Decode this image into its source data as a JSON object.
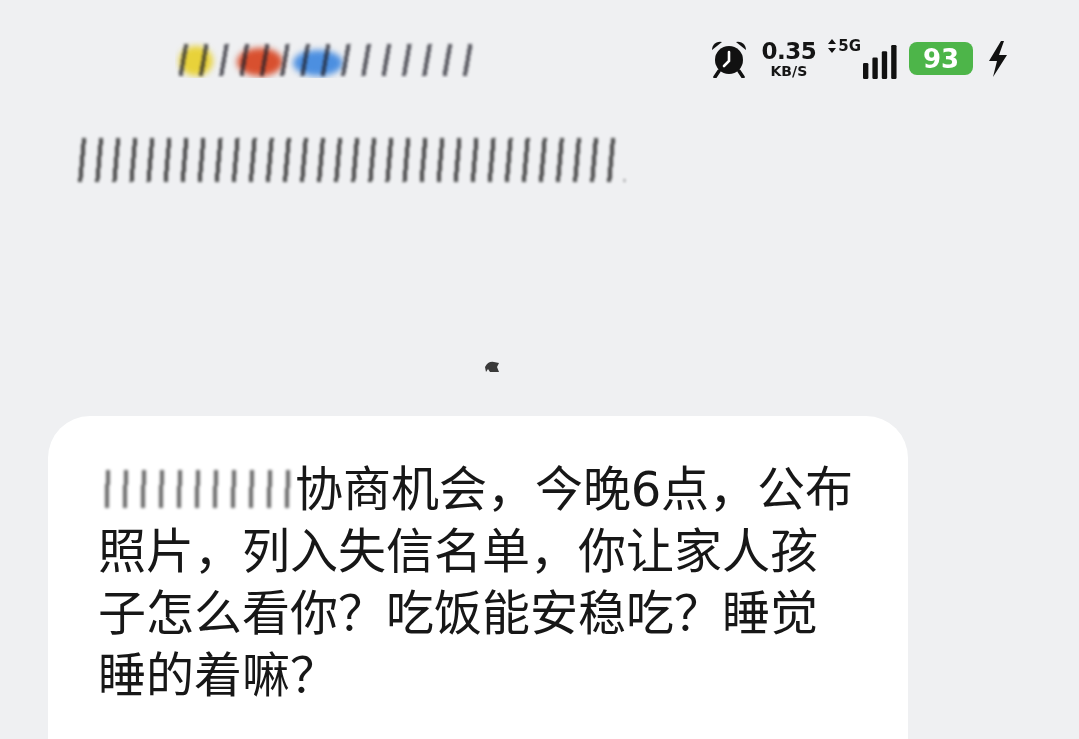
{
  "status_bar": {
    "left_blurred": true,
    "speed": "0.35",
    "speed_unit": "KB/S",
    "network": "5G",
    "battery": "93",
    "charging": true
  },
  "contact": {
    "blurred": true
  },
  "timestamp": {
    "blurred": true
  },
  "messages": [
    {
      "kind": "received",
      "blurred_prefix": true,
      "text": "协商机会，今晚6点，公布照片，列入失信名单，你让家人孩子怎么看你？吃饭能安稳吃？睡觉睡的着嘛？"
    }
  ]
}
